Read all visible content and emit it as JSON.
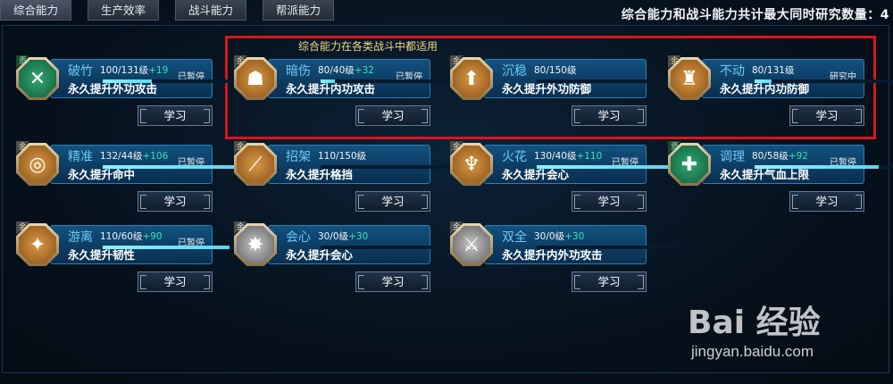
{
  "tabs": [
    {
      "label": "综合能力",
      "active": true
    },
    {
      "label": "生产效率",
      "active": false
    },
    {
      "label": "战斗能力",
      "active": false
    },
    {
      "label": "帮派能力",
      "active": false
    }
  ],
  "top_info": "综合能力和战斗能力共计最大同时研究数量：4",
  "highlight_label": "综合能力在各类战斗中都适用",
  "skills": [
    {
      "badge": "贡",
      "tier": "green",
      "icon": "crossed-swords-icon",
      "glyph": "✕",
      "name": "破竹",
      "level": "100/131级",
      "plus": "+19",
      "status": "已暂停",
      "progress": 0.35,
      "desc": "永久提升外功攻击",
      "button": "学习"
    },
    {
      "badge": "金",
      "tier": "gold",
      "icon": "meditation-icon",
      "glyph": "☗",
      "name": "暗伤",
      "level": "80/40级",
      "plus": "+32",
      "status": "已暂停",
      "progress": 0.1,
      "desc": "永久提升内功攻击",
      "button": "学习"
    },
    {
      "badge": "金",
      "tier": "gold",
      "icon": "shield-arrow-icon",
      "glyph": "⬆",
      "name": "沉稳",
      "level": "80/150级",
      "plus": "",
      "status": "",
      "progress": 0.0,
      "desc": "永久提升外功防御",
      "button": "学习"
    },
    {
      "badge": "金",
      "tier": "gold",
      "icon": "figure-shield-icon",
      "glyph": "♜",
      "name": "不动",
      "level": "80/131级",
      "plus": "",
      "status": "研究中",
      "progress": 0.12,
      "desc": "永久提升内功防御",
      "button": "学习"
    },
    {
      "badge": "金",
      "tier": "gold",
      "icon": "target-icon",
      "glyph": "◎",
      "name": "精准",
      "level": "132/44级",
      "plus": "+106",
      "status": "已暂停",
      "progress": 0.95,
      "desc": "永久提升命中",
      "button": "学习"
    },
    {
      "badge": "金",
      "tier": "gold",
      "icon": "parry-icon",
      "glyph": "⟋",
      "name": "招架",
      "level": "110/150级",
      "plus": "",
      "status": "",
      "progress": 0.0,
      "desc": "永久提升格挡",
      "button": "学习"
    },
    {
      "badge": "金",
      "tier": "gold",
      "icon": "spear-icon",
      "glyph": "♆",
      "name": "火花",
      "level": "130/40级",
      "plus": "+110",
      "status": "已暂停",
      "progress": 0.95,
      "desc": "永久提升会心",
      "button": "学习"
    },
    {
      "badge": "贡",
      "tier": "green",
      "icon": "heal-figure-icon",
      "glyph": "✚",
      "name": "调理",
      "level": "80/58级",
      "plus": "+92",
      "status": "已暂停",
      "progress": 0.88,
      "desc": "永久提升气血上限",
      "button": "学习"
    },
    {
      "badge": "金",
      "tier": "gold",
      "icon": "shuriken-icon",
      "glyph": "✦",
      "name": "游离",
      "level": "110/60级",
      "plus": "+90",
      "status": "已暂停",
      "progress": 0.9,
      "desc": "永久提升韧性",
      "button": "学习"
    },
    {
      "badge": "金",
      "tier": "silver",
      "icon": "burst-figure-icon",
      "glyph": "✸",
      "name": "会心",
      "level": "30/0级",
      "plus": "+30",
      "status": "",
      "progress": 0.0,
      "desc": "永久提升会心",
      "button": "学习"
    },
    {
      "badge": "金",
      "tier": "silver",
      "icon": "double-swords-icon",
      "glyph": "⚔",
      "name": "双全",
      "level": "30/0级",
      "plus": "+30",
      "status": "",
      "progress": 0.0,
      "desc": "永久提升内外功攻击",
      "button": "学习"
    }
  ],
  "watermark": {
    "logo": "Bai 经验",
    "url": "jingyan.baidu.com"
  }
}
